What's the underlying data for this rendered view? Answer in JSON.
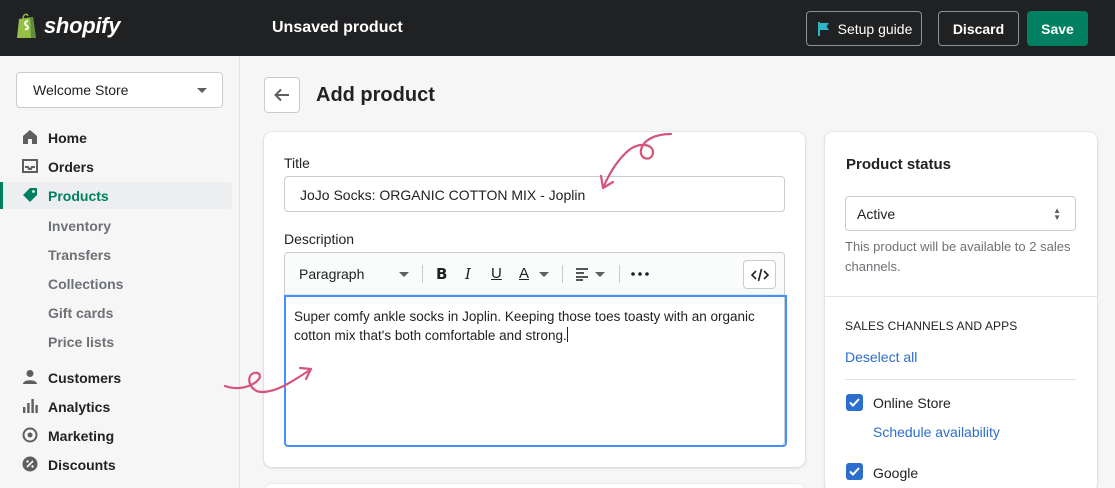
{
  "topbar": {
    "brand": "shopify",
    "title": "Unsaved product",
    "setup_guide": "Setup guide",
    "discard": "Discard",
    "save": "Save"
  },
  "sidebar": {
    "store": "Welcome Store",
    "items": [
      {
        "label": "Home",
        "icon": "home-icon"
      },
      {
        "label": "Orders",
        "icon": "orders-icon"
      },
      {
        "label": "Products",
        "icon": "tag-icon",
        "active": true
      },
      {
        "label": "Customers",
        "icon": "person-icon"
      },
      {
        "label": "Analytics",
        "icon": "bar-chart-icon"
      },
      {
        "label": "Marketing",
        "icon": "target-icon"
      },
      {
        "label": "Discounts",
        "icon": "discount-icon"
      }
    ],
    "product_subitems": [
      "Inventory",
      "Transfers",
      "Collections",
      "Gift cards",
      "Price lists"
    ]
  },
  "page": {
    "title": "Add product"
  },
  "product_form": {
    "title_label": "Title",
    "title_value": "JoJo Socks: ORGANIC COTTON MIX - Joplin",
    "description_label": "Description",
    "format_select": "Paragraph",
    "description_text": "Super comfy ankle socks in Joplin. Keeping those toes toasty with an organic cotton mix that's both comfortable and strong."
  },
  "status_card": {
    "title": "Product status",
    "status_value": "Active",
    "help_text": "This product will be available to 2 sales channels.",
    "channels_heading": "SALES CHANNELS AND APPS",
    "deselect_all": "Deselect all",
    "channels": [
      {
        "label": "Online Store",
        "checked": true
      },
      {
        "label": "Google",
        "checked": true
      }
    ],
    "schedule_link": "Schedule availability"
  },
  "colors": {
    "brand_green": "#008060",
    "link_blue": "#2c6ecb",
    "focus_blue": "#458fff",
    "annotation_pink": "#d4547a"
  }
}
